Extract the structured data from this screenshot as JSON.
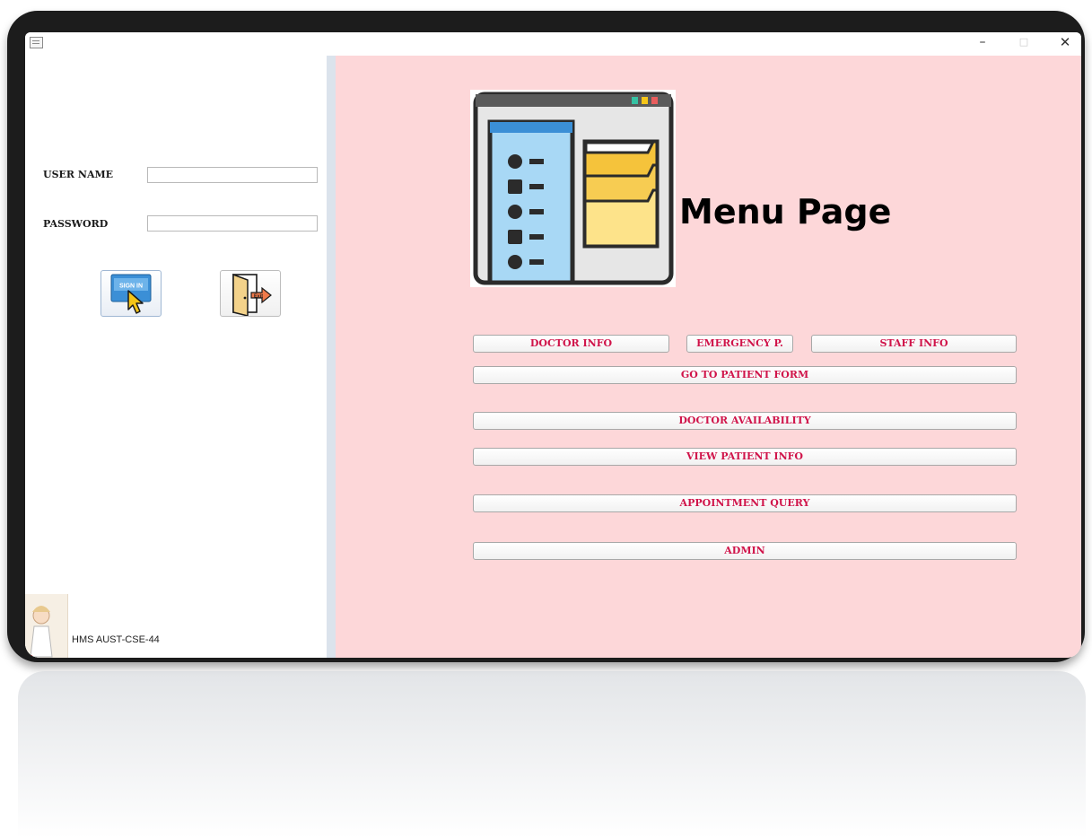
{
  "window": {
    "minimize_glyph": "–",
    "maximize_glyph": "□",
    "close_glyph": "✕"
  },
  "login": {
    "username_label": "USER NAME",
    "username_value": "",
    "password_label": "PASSWORD",
    "password_value": "",
    "signin_icon_text": "SIGN IN",
    "exit_icon_text": "Exit"
  },
  "footer": {
    "text": "HMS  AUST-CSE-44"
  },
  "menu": {
    "title": "Menu Page",
    "buttons": {
      "doctor_info": "DOCTOR INFO",
      "emergency": "EMERGENCY  P.",
      "staff_info": "STAFF INFO",
      "patient_form": "GO TO PATIENT FORM",
      "doctor_availability": "DOCTOR AVAILABILITY",
      "view_patient": "VIEW PATIENT INFO",
      "appointment": "APPOINTMENT QUERY",
      "admin": "ADMIN"
    }
  },
  "colors": {
    "menu_background": "#fdd7d9",
    "button_text": "#d0144a",
    "divider": "#dbe3ec"
  }
}
